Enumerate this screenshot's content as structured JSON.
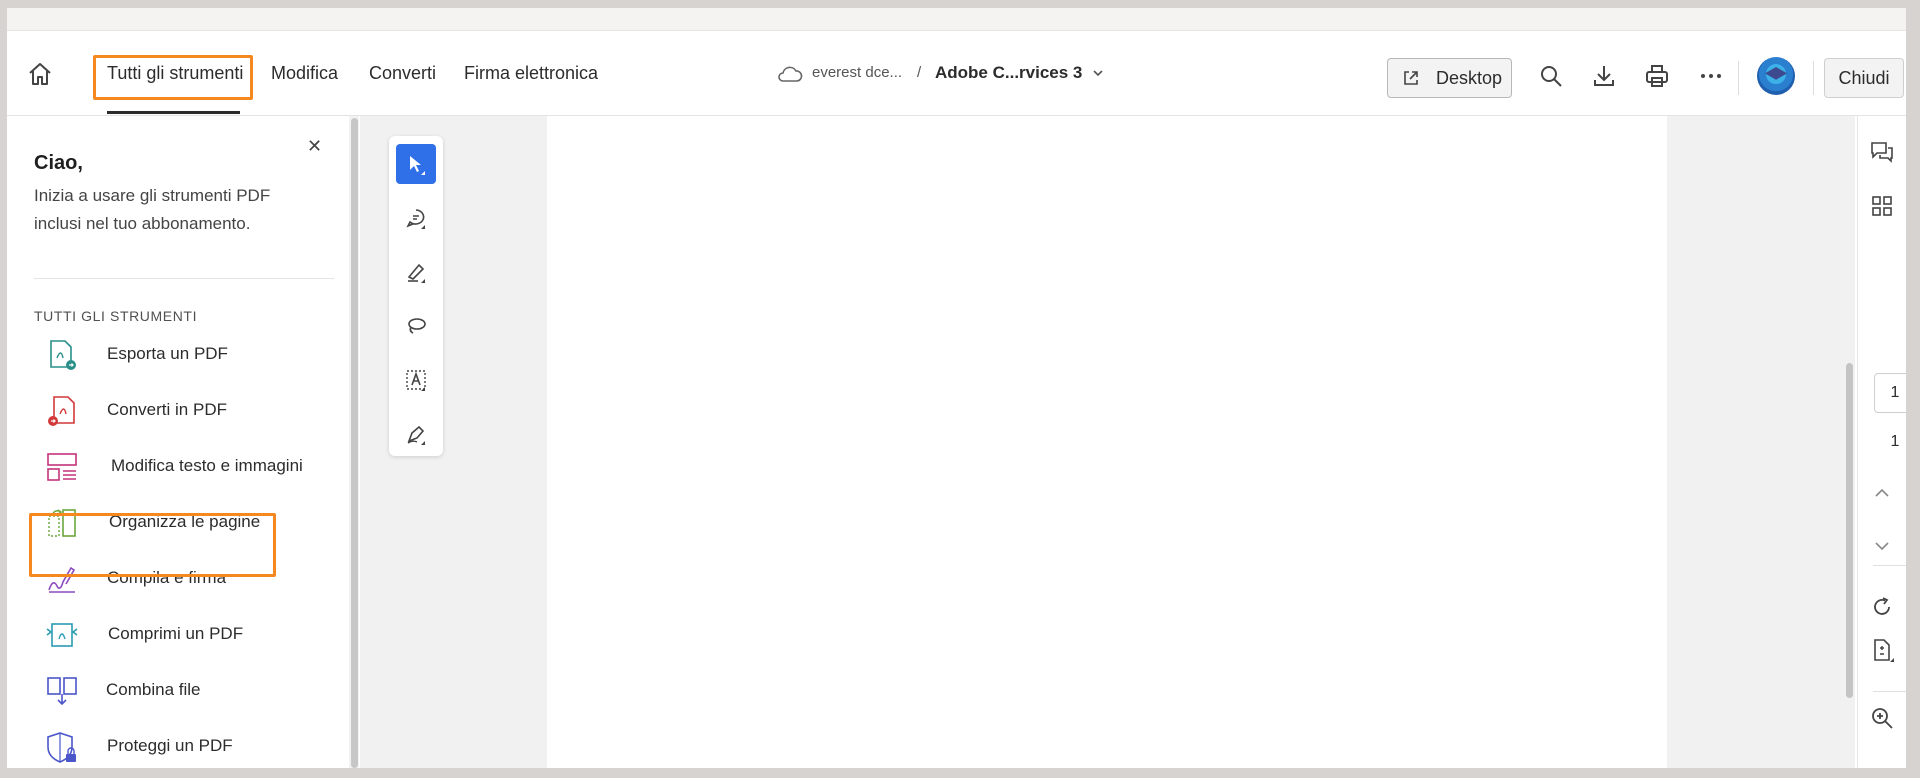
{
  "topbar": {
    "tabs": [
      "Tutti gli strumenti",
      "Modifica",
      "Converti",
      "Firma elettronica"
    ],
    "breadcrumb_folder": "everest dce...",
    "breadcrumb_separator": "/",
    "document_title": "Adobe C...rvices 3",
    "desktop_label": "Desktop",
    "close_label": "Chiudi"
  },
  "panel": {
    "greeting": "Ciao,",
    "description": "Inizia a usare gli strumenti PDF inclusi nel tuo abbonamento.",
    "section_title": "TUTTI GLI STRUMENTI",
    "tools": [
      {
        "label": "Esporta un PDF",
        "icon": "export-pdf-icon"
      },
      {
        "label": "Converti in PDF",
        "icon": "convert-pdf-icon"
      },
      {
        "label": "Modifica testo e immagini",
        "icon": "edit-text-images-icon"
      },
      {
        "label": "Organizza le pagine",
        "icon": "organize-pages-icon"
      },
      {
        "label": "Compila e firma",
        "icon": "fill-sign-icon"
      },
      {
        "label": "Comprimi un PDF",
        "icon": "compress-pdf-icon"
      },
      {
        "label": "Combina file",
        "icon": "combine-files-icon"
      },
      {
        "label": "Proteggi un PDF",
        "icon": "protect-pdf-icon"
      }
    ]
  },
  "pages": {
    "current": "1",
    "total": "1"
  },
  "colors": {
    "highlight": "#f5891f",
    "selected_tool": "#2f6fe7"
  }
}
